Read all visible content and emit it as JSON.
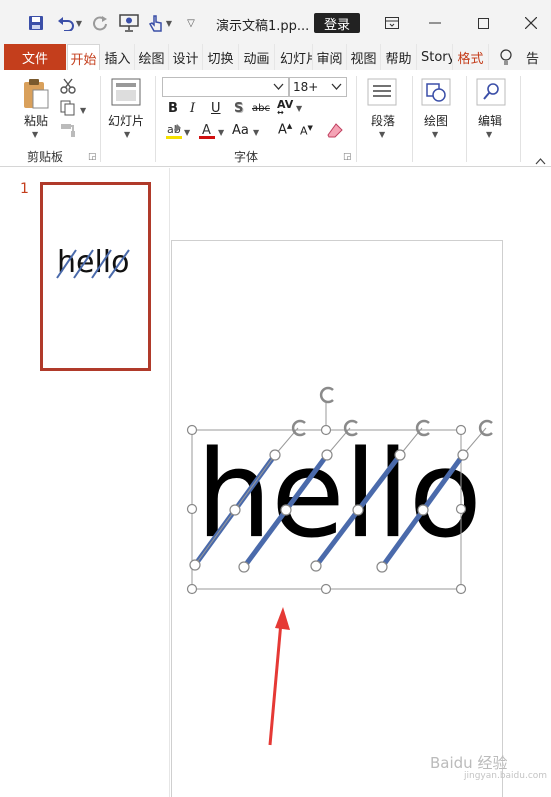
{
  "window": {
    "title": "演示文稿1.pp...",
    "login_label": "登录"
  },
  "tabs": [
    {
      "label": "文件"
    },
    {
      "label": "开始"
    },
    {
      "label": "插入"
    },
    {
      "label": "绘图"
    },
    {
      "label": "设计"
    },
    {
      "label": "切换"
    },
    {
      "label": "动画"
    },
    {
      "label": "幻灯片"
    },
    {
      "label": "审阅"
    },
    {
      "label": "视图"
    },
    {
      "label": "帮助"
    },
    {
      "label": "Story"
    },
    {
      "label": "格式"
    },
    {
      "label": "告"
    }
  ],
  "ribbon": {
    "clipboard": {
      "paste_label": "粘贴",
      "group_label": "剪贴板"
    },
    "slides": {
      "new_slide_label": "幻灯片"
    },
    "font": {
      "font_name": "",
      "font_size": "18+",
      "group_label": "字体",
      "change_case": "Aa"
    },
    "paragraph": {
      "label": "段落"
    },
    "drawing": {
      "label": "绘图"
    },
    "editing": {
      "label": "编辑"
    }
  },
  "thumbnails": [
    {
      "number": "1",
      "text": "hello"
    }
  ],
  "slide": {
    "text": "hello"
  },
  "watermark": {
    "text": "Baidu 经验",
    "sub": "jingyan.baidu.com"
  },
  "colors": {
    "accent": "#c43e1c",
    "line": "#4a6aab",
    "arrow": "#e53935"
  }
}
